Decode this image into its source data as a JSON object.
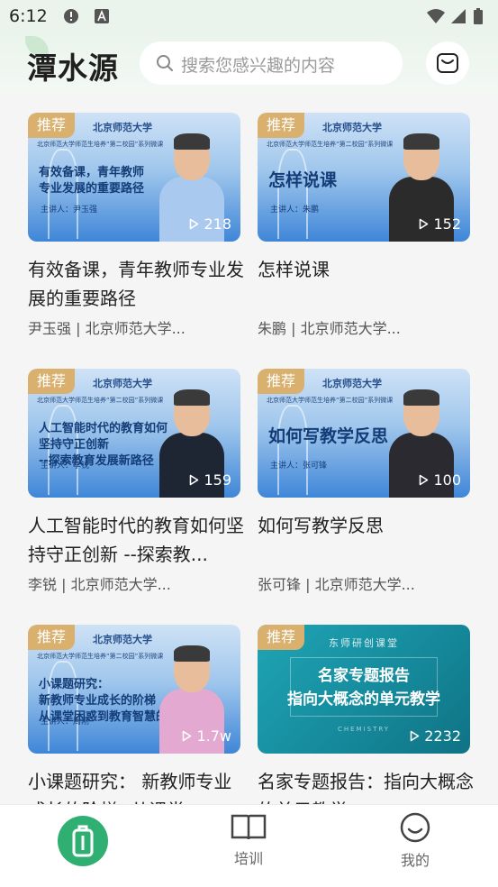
{
  "status_bar": {
    "time": "6:12"
  },
  "header": {
    "logo": "潭水源",
    "search_placeholder": "搜索您感兴趣的内容"
  },
  "cards": [
    {
      "badge": "推荐",
      "thumb_style": "blue",
      "university": "北京师范大学",
      "series_line": "北京师范大学师范生培养“第二校园”系列微课",
      "thumb_title": [
        "有效备课，青年教师",
        "专业发展的重要路径"
      ],
      "speaker": "主讲人：尹玉强",
      "views": "218",
      "title": "有效备课，青年教师专业发展的重要路径",
      "meta": "尹玉强 | 北京师范大学...",
      "person_color": "#a9c9ee"
    },
    {
      "badge": "推荐",
      "thumb_style": "blue",
      "university": "北京师范大学",
      "series_line": "北京师范大学师范生培养“第二校园”系列微课",
      "thumb_title": [
        "怎样说课"
      ],
      "speaker": "主讲人：朱鹏",
      "views": "152",
      "title": "怎样说课",
      "meta": "朱鹏 | 北京师范大学...",
      "person_color": "#2b2b2b"
    },
    {
      "badge": "推荐",
      "thumb_style": "blue",
      "university": "北京师范大学",
      "series_line": "北京师范大学师范生培养“第二校园”系列微课",
      "thumb_title": [
        "人工智能时代的教育如何",
        "坚持守正创新",
        "--探索教育发展新路径"
      ],
      "speaker": "主讲人：李锐",
      "views": "159",
      "title": "人工智能时代的教育如何坚持守正创新 --探索教...",
      "meta": "李锐 | 北京师范大学...",
      "person_color": "#1f2633"
    },
    {
      "badge": "推荐",
      "thumb_style": "blue",
      "university": "北京师范大学",
      "series_line": "北京师范大学师范生培养“第二校园”系列微课",
      "thumb_title": [
        "如何写教学反思"
      ],
      "speaker": "主讲人：张可锋",
      "views": "100",
      "title": "如何写教学反思",
      "meta": "张可锋 | 北京师范大学...",
      "person_color": "#2a2a30"
    },
    {
      "badge": "推荐",
      "thumb_style": "blue",
      "university": "北京师范大学",
      "series_line": "北京师范大学师范生培养“第二校园”系列微课",
      "thumb_title": [
        "小课题研究：",
        "新教师专业成长的阶梯",
        "从课堂困惑到教育智慧的转化实践"
      ],
      "speaker": "主讲人：周刚",
      "views": "1.7w",
      "title": "小课题研究：  新教师专业成长的阶梯--从课堂...",
      "meta": "",
      "person_color": "#e3a9d0"
    },
    {
      "badge": "推荐",
      "thumb_style": "teal",
      "thumb_top": "东师研创课堂",
      "thumb_title": [
        "名家专题报告",
        "指向大概念的单元教学"
      ],
      "thumb_bottom": "CHEMISTRY",
      "views": "2232",
      "title": "名家专题报告：指向大概念的单元教学",
      "meta": ""
    }
  ],
  "tabs": [
    {
      "label": ""
    },
    {
      "label": "培训"
    },
    {
      "label": "我的"
    }
  ]
}
